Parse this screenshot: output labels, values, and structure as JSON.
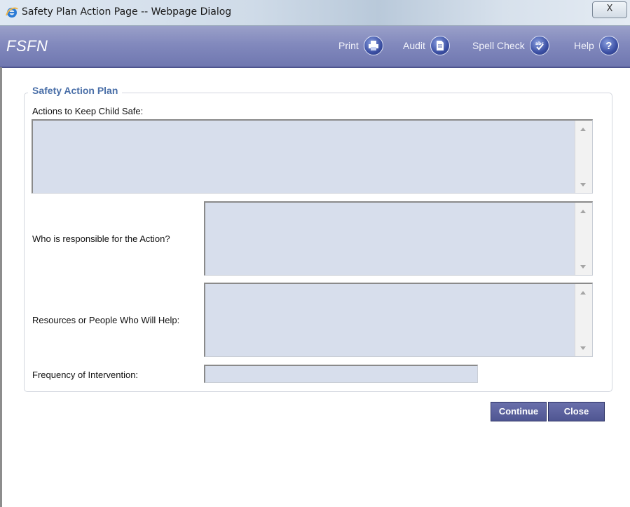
{
  "window": {
    "title": "Safety Plan Action Page -- Webpage Dialog",
    "close_label": "X"
  },
  "app": {
    "brand": "FSFN",
    "toolbar": [
      {
        "label": "Print",
        "icon": "printer-icon"
      },
      {
        "label": "Audit",
        "icon": "document-icon"
      },
      {
        "label": "Spell Check",
        "icon": "spell-check-icon"
      },
      {
        "label": "Help",
        "icon": "help-icon",
        "glyph": "?"
      }
    ]
  },
  "form": {
    "section_title": "Safety Action Plan",
    "actions_label": "Actions to Keep Child Safe:",
    "actions_value": "",
    "responsible_label": "Who is responsible for the Action?",
    "responsible_value": "",
    "resources_label": "Resources or People Who Will Help:",
    "resources_value": "",
    "frequency_label": "Frequency of Intervention:",
    "frequency_value": ""
  },
  "buttons": {
    "continue_label": "Continue",
    "close_label": "Close"
  },
  "colors": {
    "header_bg": "#8289bd",
    "field_bg": "#d7deec",
    "legend": "#4a6fa8",
    "button_bg": "#5a609c"
  }
}
